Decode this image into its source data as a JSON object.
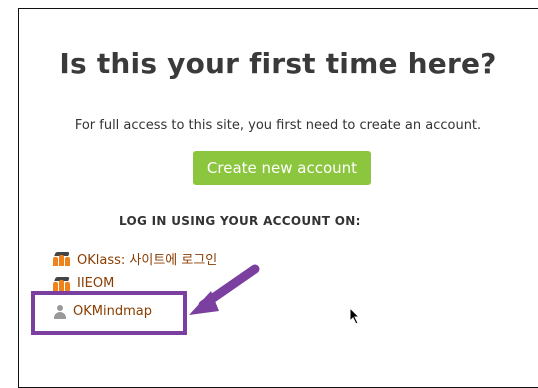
{
  "title": "Is this your first time here?",
  "intro_text": "For full access to this site, you first need to create an account.",
  "create_button_label": "Create new account",
  "login_heading": "LOG IN USING YOUR ACCOUNT ON:",
  "providers": [
    {
      "label": "OKlass: 사이트에 로그인",
      "icon": "moodle-icon"
    },
    {
      "label": "IIEOM",
      "icon": "moodle-icon"
    },
    {
      "label": "OKMindmap",
      "icon": "user-icon"
    }
  ],
  "colors": {
    "accent_button": "#8cc63f",
    "highlight": "#7b3fa0",
    "link": "#8a3d00"
  }
}
